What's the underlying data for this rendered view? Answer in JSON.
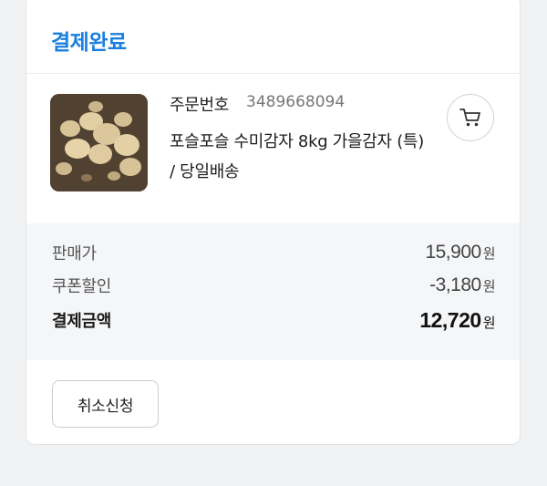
{
  "order": {
    "status": "결제완료",
    "order_number_label": "주문번호",
    "order_number": "3489668094",
    "product_name": "포슬포슬 수미감자 8kg 가을감자 (특) / 당일배송",
    "product_image_icon": "potato-photo",
    "cart_icon": "cart-icon"
  },
  "summary": {
    "sale_price_label": "판매가",
    "sale_price": "15,900",
    "coupon_label": "쿠폰할인",
    "coupon": "-3,180",
    "total_label": "결제금액",
    "total": "12,720",
    "currency_unit": "원"
  },
  "actions": {
    "cancel_label": "취소신청"
  },
  "colors": {
    "status_blue": "#1a7fe0",
    "summary_bg": "#f5f6f8"
  }
}
